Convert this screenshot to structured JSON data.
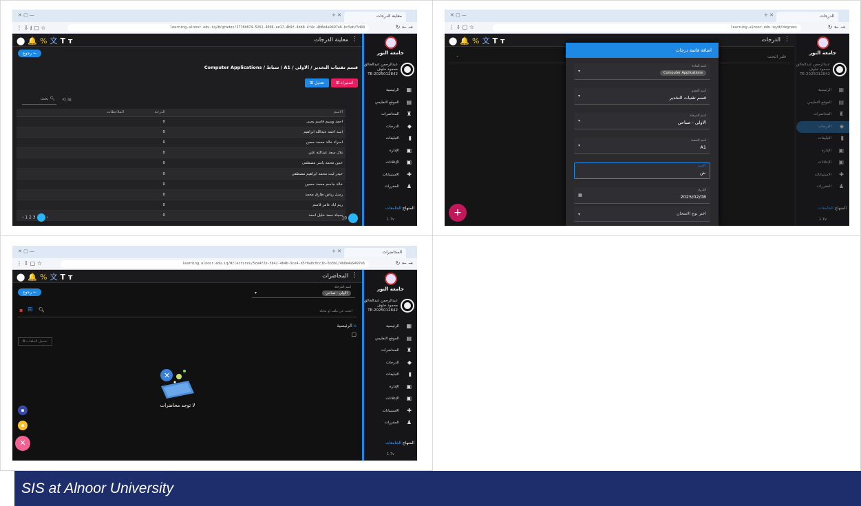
{
  "caption": "SIS at Alnoor University",
  "common": {
    "university": "جامعة النور",
    "user_name": "عبدالرحمن عبدالخالق محمود خلوف",
    "user_id": "TE-2025012842",
    "brand_prefix": "المنهاج",
    "brand_word": "الجامعات",
    "version": "1.7v",
    "nav": [
      "الرئيسية",
      "الموقع التعليمي",
      "المحاضرات",
      "الدرجات",
      "التبليغات",
      "الإدارة",
      "الإعلانات",
      "الاستبيانات",
      "المقررات"
    ]
  },
  "p1": {
    "tab_title": "معاينة الدرجات",
    "url": "learning.alnoor.edu.iq/#/grades/2776b874-5261-4096-ae17-4b9f-4bb8-4f4c-4b8e4a9497e6-bc5ab/5d49",
    "app_title": "معاينة الدرجات",
    "back": "رجوع",
    "breadcrumb": "قسم تقنيات التخدير / الاولى / A1 / شباط / Computer Applications",
    "btn_edit": "تعديل",
    "btn_print": "استيراد",
    "search": "بحث",
    "columns": [
      "الاسم",
      "الدرجة",
      "الملاحظات"
    ],
    "rows": [
      {
        "name": "احمد وسيم قاسم يحيى",
        "grade": "0"
      },
      {
        "name": "اسد احمد عبدالله ابراهيم",
        "grade": "0"
      },
      {
        "name": "اسراء خالد محمد حسن",
        "grade": "0"
      },
      {
        "name": "بلال سعد عبدالله علي",
        "grade": "0"
      },
      {
        "name": "حنين محمد ياسر مصطفى",
        "grade": "0"
      },
      {
        "name": "حيدر ليث محمد ابراهيم مصطفى",
        "grade": "0"
      },
      {
        "name": "خالد جاسم محمد حسين",
        "grade": "0"
      },
      {
        "name": "رسل رياض طارق محمد",
        "grade": "0"
      },
      {
        "name": "ريم اياد عامر قاسم",
        "grade": "0"
      },
      {
        "name": "سجاد سعد خليل احمد",
        "grade": "0"
      }
    ],
    "pager": "1 2 3",
    "page_size": "10"
  },
  "p2": {
    "tab_title": "الدرجات",
    "url": "learning.alnoor.edu.iq/#/degrees",
    "app_title": "الدرجات",
    "filter": "فلتر البحث",
    "modal_title": "اضافة قائمة درجات",
    "fields": [
      {
        "label": "اسم المادة",
        "value": "Computer Applications"
      },
      {
        "label": "اسم القسم",
        "value": "قسم تقنيات التخدير"
      },
      {
        "label": "اسم المرحلة",
        "value": "الاولى - صباحي"
      },
      {
        "label": "اسم الشعبة",
        "value": "A1"
      },
      {
        "label": "الاسم",
        "value": "ش"
      },
      {
        "label": "التاريخ",
        "value": "2025/02/08"
      },
      {
        "label": "",
        "value": "اختر نوع الامتحان"
      }
    ]
  },
  "p3": {
    "tab_title": "المحاضرات",
    "url": "learning.alnoor.edu.iq/#/lectures/5ce4f2b-5b42-4b4b-9ce4-d5f0a8c0cc1b-6b3b1/4b8e4a9497e6",
    "app_title": "المحاضرات",
    "back": "رجوع",
    "stage_label": "اسم المرحلة",
    "stage_chip": "الاولى - صباحي",
    "search_ph": "ابحث عن ملف او مجلد",
    "home": "الرئيسية",
    "folder_chip": "تحميل الملفات",
    "empty": "لا توجد محاضرات"
  }
}
